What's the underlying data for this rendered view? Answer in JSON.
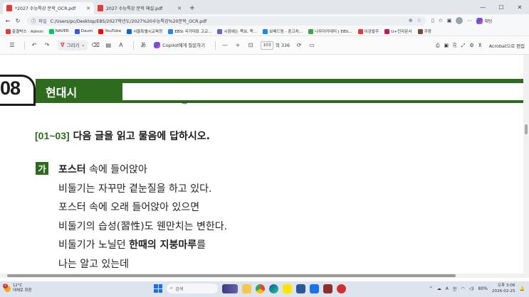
{
  "browser": {
    "tabs": [
      {
        "title": "*2027 수능특강 문학_OCR.pdf",
        "active": true
      },
      {
        "title": "2027 수능특강 문학 해설.pdf",
        "active": false
      }
    ],
    "address": {
      "file_label": "파일",
      "url": "C:/Users/pc/Desktop/EBS/2027학년도/2027%20수능특강%20문학_OCR.pdf"
    },
    "copilot_label": "채팅",
    "bookmarks": [
      {
        "label": "출결박스 · Admin",
        "color": "#e53935"
      },
      {
        "label": "NAVER",
        "color": "#03c75a"
      },
      {
        "label": "Daum",
        "color": "#3b5bdb"
      },
      {
        "label": "YouTube",
        "color": "#ff0000"
      },
      {
        "label": "서울특별시교육청",
        "color": "#1565c0"
      },
      {
        "label": "EBSi 국가대표 고교...",
        "color": "#2f80ed"
      },
      {
        "label": "시험에는 족보, 족...",
        "color": "#5c6bc0"
      },
      {
        "label": "보배드림 - 중고차...",
        "color": "#1e88e5"
      },
      {
        "label": "나무아카데미 | EBS...",
        "color": "#43a047"
      },
      {
        "label": "이감발주",
        "color": "#e53935"
      },
      {
        "label": "U+전자문서",
        "color": "#c2185b"
      },
      {
        "label": "쿠팡",
        "color": "#6d4c41"
      }
    ]
  },
  "pdf_toolbar": {
    "draw_label": "그리기",
    "copilot_ask": "Copilot에게 질문하기",
    "current_page": "103",
    "total_pages": "의 336",
    "acrobat_label": "Acrobat으로 편집"
  },
  "document": {
    "section_number": "08",
    "section_title": "현대시",
    "question_range": "[01~03]",
    "question_text": "다음 글을 읽고 물음에 답하시오.",
    "passage_label": "가",
    "poem_lines": [
      {
        "pre": "",
        "bold": "포스터",
        "post": " 속에 들어앉아"
      },
      {
        "pre": "비둘기는 자꾸만 곁눈질을 하고 있다.",
        "bold": "",
        "post": ""
      },
      {
        "pre": "포스터 속에 오래 들어앉아 있으면",
        "bold": "",
        "post": ""
      },
      {
        "pre": "비둘기의 습성(習性)도 웬만치는 변한다.",
        "bold": "",
        "post": ""
      },
      {
        "pre": "비둘기가 노닐던 ",
        "bold": "한때의 지붕마루",
        "post": "를"
      },
      {
        "pre": "나는 알고 있는데",
        "bold": "",
        "post": ""
      }
    ]
  },
  "taskbar": {
    "weather_temp": "12°C",
    "weather_desc": "대체로 화창",
    "notification_count": "2",
    "search_label": "검색",
    "lang_label": "A",
    "ime_label": "한",
    "battery": "80%",
    "time": "오후 3:06",
    "date": "2026-02-25"
  }
}
